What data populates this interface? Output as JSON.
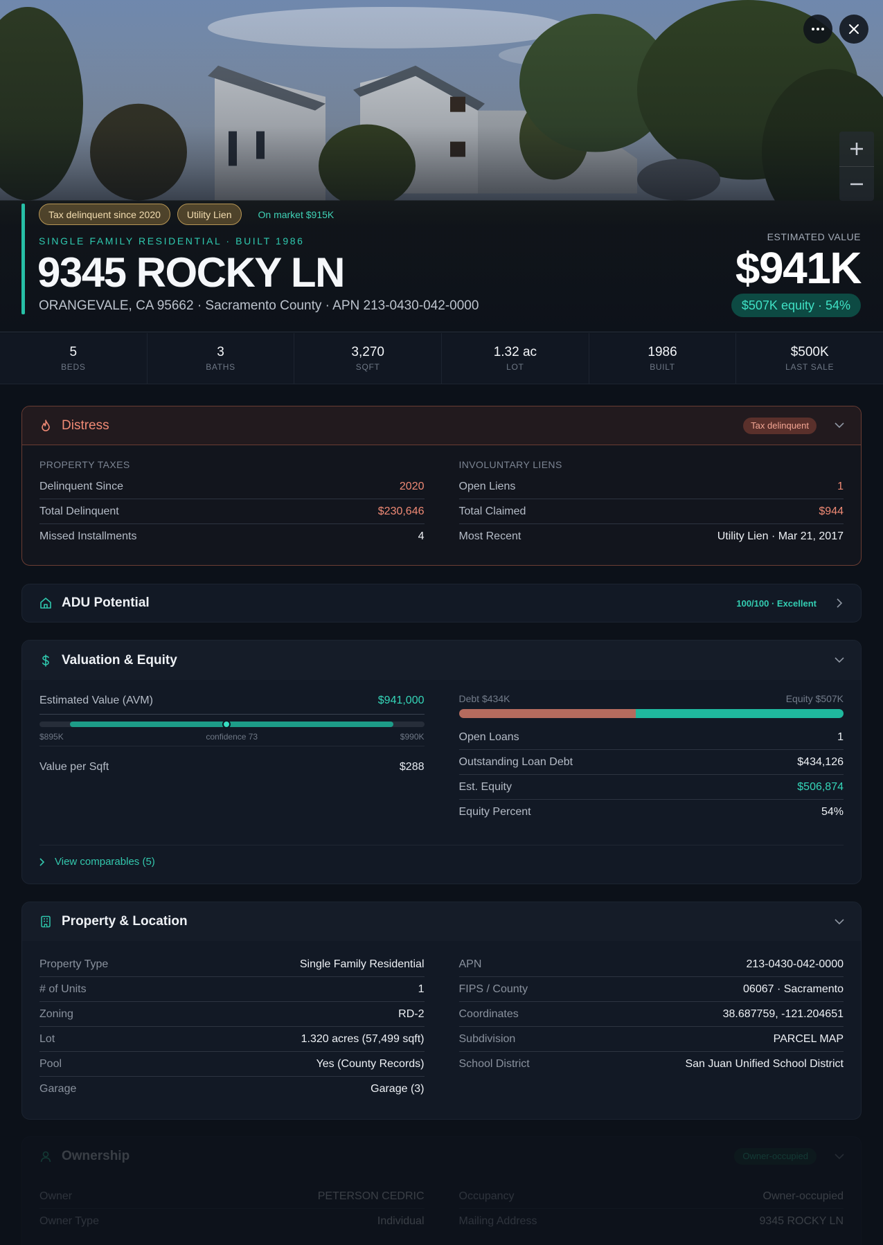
{
  "hero": {
    "chips": [
      "Tax delinquent since 2020",
      "Utility Lien"
    ],
    "market_chip": "On market $915K",
    "kicker": "SINGLE FAMILY RESIDENTIAL · BUILT 1986",
    "address": "9345 ROCKY LN",
    "subaddress": "ORANGEVALE, CA 95662 · Sacramento County · APN 213-0430-042-0000",
    "value_label": "ESTIMATED VALUE",
    "value": "$941K",
    "equity_pill": "$507K equity · 54%"
  },
  "stats": [
    {
      "value": "5",
      "label": "BEDS"
    },
    {
      "value": "3",
      "label": "BATHS"
    },
    {
      "value": "3,270",
      "label": "SQFT"
    },
    {
      "value": "1.32 ac",
      "label": "LOT"
    },
    {
      "value": "1986",
      "label": "BUILT"
    },
    {
      "value": "$500K",
      "label": "LAST SALE"
    }
  ],
  "distress": {
    "title": "Distress",
    "badge": "Tax delinquent",
    "left_title": "PROPERTY TAXES",
    "left_rows": [
      {
        "k": "Delinquent Since",
        "v": "2020"
      },
      {
        "k": "Total Delinquent",
        "v": "$230,646"
      },
      {
        "k": "Missed Installments",
        "v": "4"
      }
    ],
    "right_title": "INVOLUNTARY LIENS",
    "right_rows": [
      {
        "k": "Open Liens",
        "v": "1"
      },
      {
        "k": "Total Claimed",
        "v": "$944"
      },
      {
        "k": "Most Recent",
        "v": "Utility Lien · Mar 21, 2017"
      }
    ]
  },
  "adu": {
    "title": "ADU Potential",
    "score": "100/100 · Excellent"
  },
  "valuation": {
    "title": "Valuation & Equity",
    "avm_label": "Estimated Value (AVM)",
    "avm_value": "$941,000",
    "range_low": "$895K",
    "range_high": "$990K",
    "confidence": "confidence 73",
    "range": {
      "low": 895000,
      "high": 990000,
      "estimate": 941000
    },
    "vps_label": "Value per Sqft",
    "vps_value": "$288",
    "debt_label": "Debt $434K",
    "equity_label": "Equity $507K",
    "debt_share": 0.46,
    "rows": [
      {
        "k": "Open Loans",
        "v": "1"
      },
      {
        "k": "Outstanding Loan Debt",
        "v": "$434,126"
      },
      {
        "k": "Est. Equity",
        "v": "$506,874"
      },
      {
        "k": "Equity Percent",
        "v": "54%"
      }
    ],
    "comps": "View comparables (5)"
  },
  "property": {
    "title": "Property & Location",
    "left_rows": [
      {
        "k": "Property Type",
        "v": "Single Family Residential"
      },
      {
        "k": "# of Units",
        "v": "1"
      },
      {
        "k": "Zoning",
        "v": "RD-2"
      },
      {
        "k": "Lot",
        "v": "1.320 acres (57,499 sqft)"
      },
      {
        "k": "Pool",
        "v": "Yes (County Records)"
      },
      {
        "k": "Garage",
        "v": "Garage (3)"
      }
    ],
    "right_rows": [
      {
        "k": "APN",
        "v": "213-0430-042-0000"
      },
      {
        "k": "FIPS / County",
        "v": "06067 · Sacramento"
      },
      {
        "k": "Coordinates",
        "v": "38.687759, -121.204651"
      },
      {
        "k": "Subdivision",
        "v": "PARCEL MAP"
      },
      {
        "k": "School District",
        "v": "San Juan Unified School District"
      }
    ]
  },
  "ownership": {
    "title": "Ownership",
    "badge": "Owner-occupied",
    "left_rows": [
      {
        "k": "Owner",
        "v": "PETERSON CEDRIC"
      },
      {
        "k": "Owner Type",
        "v": "Individual"
      }
    ],
    "right_rows": [
      {
        "k": "Occupancy",
        "v": "Owner-occupied"
      },
      {
        "k": "Mailing Address",
        "v": "9345 ROCKY LN"
      }
    ]
  },
  "colors": {
    "accent": "#27bfa6",
    "danger": "#f08a75",
    "debt": "#b56b5e",
    "equity": "#1fb89e"
  }
}
